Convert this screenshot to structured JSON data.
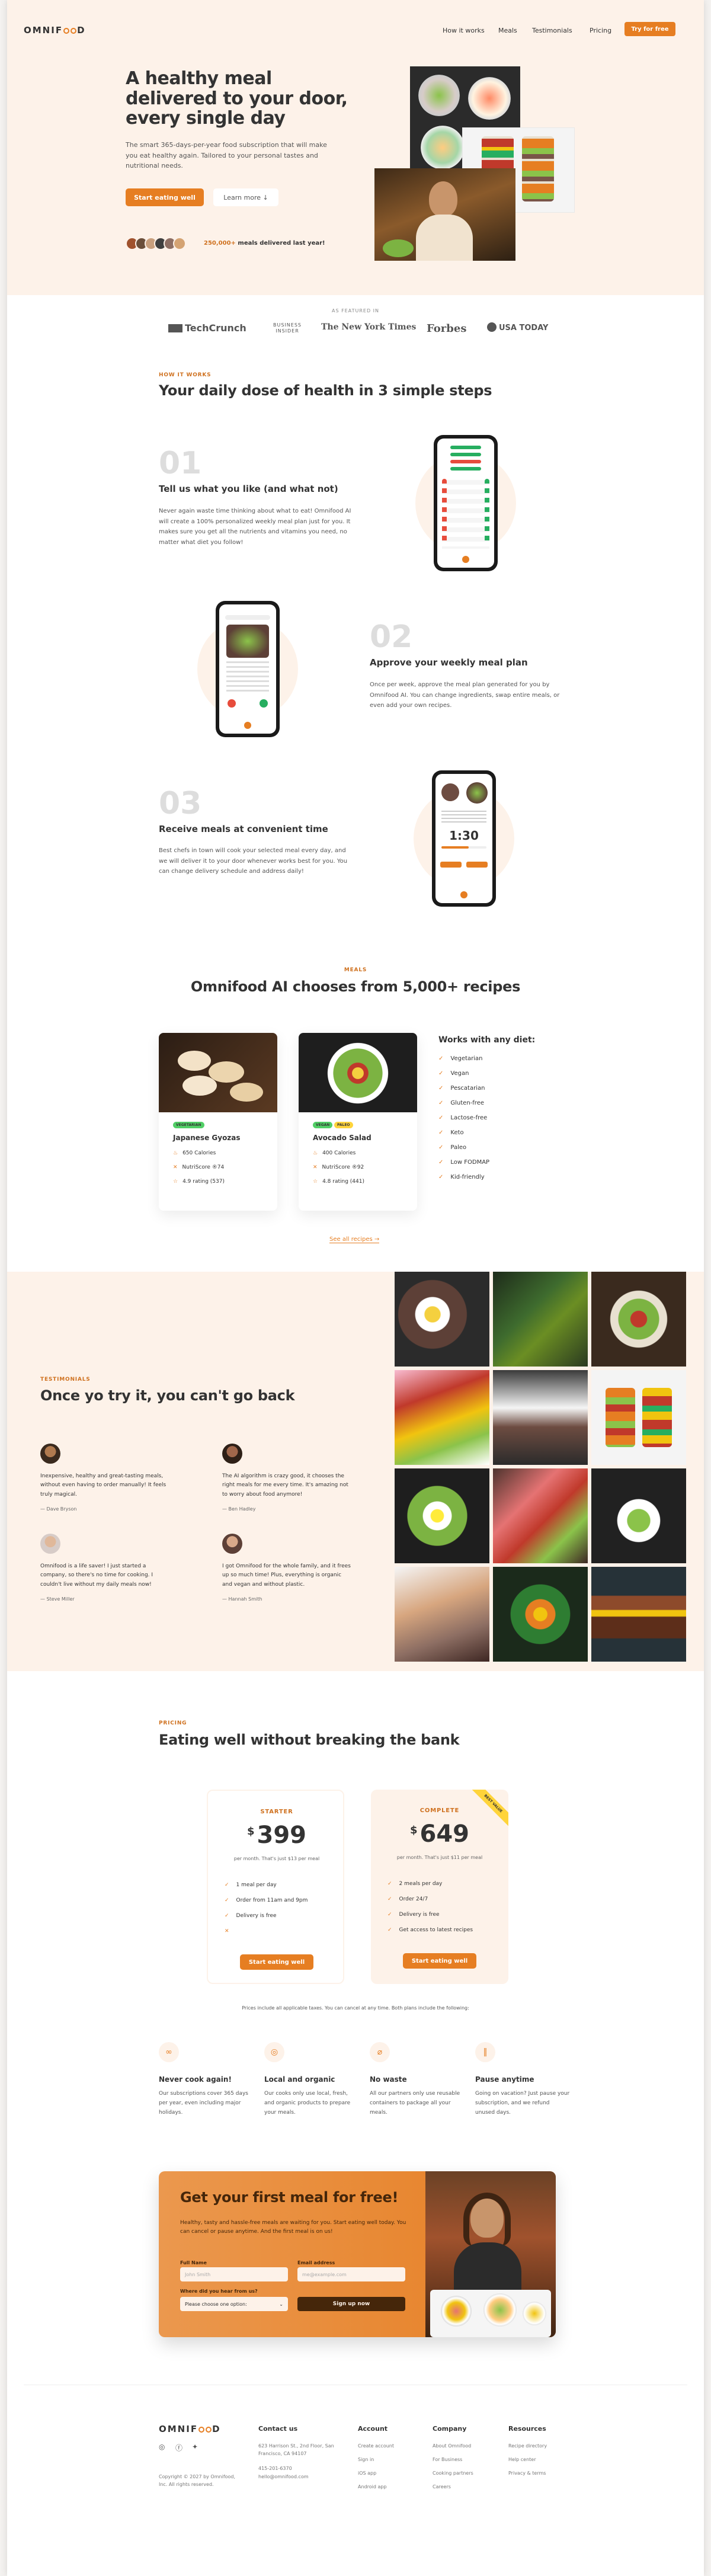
{
  "brand": {
    "logo_pre": "OMNIF",
    "logo_post": "D",
    "accent": "#e67e22"
  },
  "nav": {
    "items": [
      "How it works",
      "Meals",
      "Testimonials",
      "Pricing"
    ],
    "cta": "Try for free"
  },
  "hero": {
    "title": "A healthy meal delivered to your door, every single day",
    "text": "The smart 365-days-per-year food subscription that will make you eat healthy again. Tailored to your personal tastes and nutritional needs.",
    "btn_primary": "Start eating well",
    "btn_secondary": "Learn more ↓",
    "delivered_count": "250,000+",
    "delivered_text": "meals delivered last year!"
  },
  "featured": {
    "label": "AS FEATURED IN",
    "logos": [
      "TechCrunch",
      "BUSINESS INSIDER",
      "The New York Times",
      "Forbes",
      "USA TODAY"
    ]
  },
  "how": {
    "subheading": "HOW IT WORKS",
    "heading": "Your daily dose of health in 3 simple steps",
    "steps": [
      {
        "num": "01",
        "title": "Tell us what you like (and what not)",
        "text": "Never again waste time thinking about what to eat! Omnifood AI will create a 100% personalized weekly meal plan just for you. It makes sure you get all the nutrients and vitamins you need, no matter what diet you follow!"
      },
      {
        "num": "02",
        "title": "Approve your weekly meal plan",
        "text": "Once per week, approve the meal plan generated for you by Omnifood AI. You can change ingredients, swap entire meals, or even add your own recipes."
      },
      {
        "num": "03",
        "title": "Receive meals at convenient time",
        "text": "Best chefs in town will cook your selected meal every day, and we will deliver it to your door whenever works best for you. You can change delivery schedule and address daily!"
      }
    ],
    "phone_timer": "1:30"
  },
  "meals": {
    "subheading": "MEALS",
    "heading": "Omnifood AI chooses from 5,000+ recipes",
    "cards": [
      {
        "name": "Japanese Gyozas",
        "tags": [
          "VEGETARIAN"
        ],
        "calories": "650 Calories",
        "nutriscore": "NutriScore ®74",
        "rating": "4.9 rating (537)"
      },
      {
        "name": "Avocado Salad",
        "tags": [
          "VEGAN",
          "PALEO"
        ],
        "calories": "400 Calories",
        "nutriscore": "NutriScore ®92",
        "rating": "4.8 rating (441)"
      }
    ],
    "diets_title": "Works with any diet:",
    "diets": [
      "Vegetarian",
      "Vegan",
      "Pescatarian",
      "Gluten-free",
      "Lactose-free",
      "Keto",
      "Paleo",
      "Low FODMAP",
      "Kid-friendly"
    ],
    "all_link": "See all recipes →"
  },
  "testimonials": {
    "subheading": "TESTIMONIALS",
    "heading": "Once yo try it, you can't go back",
    "items": [
      {
        "text": "Inexpensive, healthy and great-tasting meals, without even having to order manually! It feels truly magical.",
        "name": "— Dave Bryson"
      },
      {
        "text": "The AI algorithm is crazy good, it chooses the right meals for me every time. It's amazing not to worry about food anymore!",
        "name": "— Ben Hadley"
      },
      {
        "text": "Omnifood is a life saver! I just started a company, so there's no time for cooking. I couldn't live without my daily meals now!",
        "name": "— Steve Miller"
      },
      {
        "text": "I got Omnifood for the whole family, and it frees up so much time! Plus, everything is organic and vegan and without plastic.",
        "name": "— Hannah Smith"
      }
    ]
  },
  "pricing": {
    "subheading": "PRICING",
    "heading": "Eating well without breaking the bank",
    "plans": [
      {
        "name": "STARTER",
        "currency": "$",
        "price": "399",
        "meta": "per month. That's just $13 per meal",
        "items": [
          "1 meal per day",
          "Order from 11am and 9pm",
          "Delivery is free",
          ""
        ],
        "cta": "Start eating well"
      },
      {
        "name": "COMPLETE",
        "currency": "$",
        "price": "649",
        "meta": "per month. That's just $11 per meal",
        "items": [
          "2 meals per day",
          "Order 24/7",
          "Delivery is free",
          "Get access to latest recipes"
        ],
        "cta": "Start eating well",
        "ribbon": "BEST VALUE"
      }
    ],
    "note": "Prices include all applicable taxes. You can cancel at any time. Both plans include the following:",
    "features": [
      {
        "icon": "∞",
        "title": "Never cook again!",
        "text": "Our subscriptions cover 365 days per year, even including major holidays."
      },
      {
        "icon": "◎",
        "title": "Local and organic",
        "text": "Our cooks only use local, fresh, and organic products to prepare your meals."
      },
      {
        "icon": "⌀",
        "title": "No waste",
        "text": "All our partners only use reusable containers to package all your meals."
      },
      {
        "icon": "‖",
        "title": "Pause anytime",
        "text": "Going on vacation? Just pause your subscription, and we refund unused days."
      }
    ]
  },
  "cta": {
    "title": "Get your first meal for free!",
    "text": "Healthy, tasty and hassle-free meals are waiting for you. Start eating well today. You can cancel or pause anytime. And the first meal is on us!",
    "name_label": "Full Name",
    "name_placeholder": "John Smith",
    "email_label": "Email address",
    "email_placeholder": "me@example.com",
    "select_label": "Where did you hear from us?",
    "select_value": "Please choose one option:",
    "submit": "Sign up now"
  },
  "footer": {
    "copyright": "Copyright © 2027 by Omnifood, Inc. All rights reserved.",
    "contact_title": "Contact us",
    "address": "623 Harrison St., 2nd Floor, San Francisco, CA 94107",
    "phone": "415-201-6370",
    "email": "hello@omnifood.com",
    "columns": [
      {
        "title": "Account",
        "links": [
          "Create account",
          "Sign in",
          "iOS app",
          "Android app"
        ]
      },
      {
        "title": "Company",
        "links": [
          "About Omnifood",
          "For Business",
          "Cooking partners",
          "Careers"
        ]
      },
      {
        "title": "Resources",
        "links": [
          "Recipe directory",
          "Help center",
          "Privacy & terms"
        ]
      }
    ]
  }
}
